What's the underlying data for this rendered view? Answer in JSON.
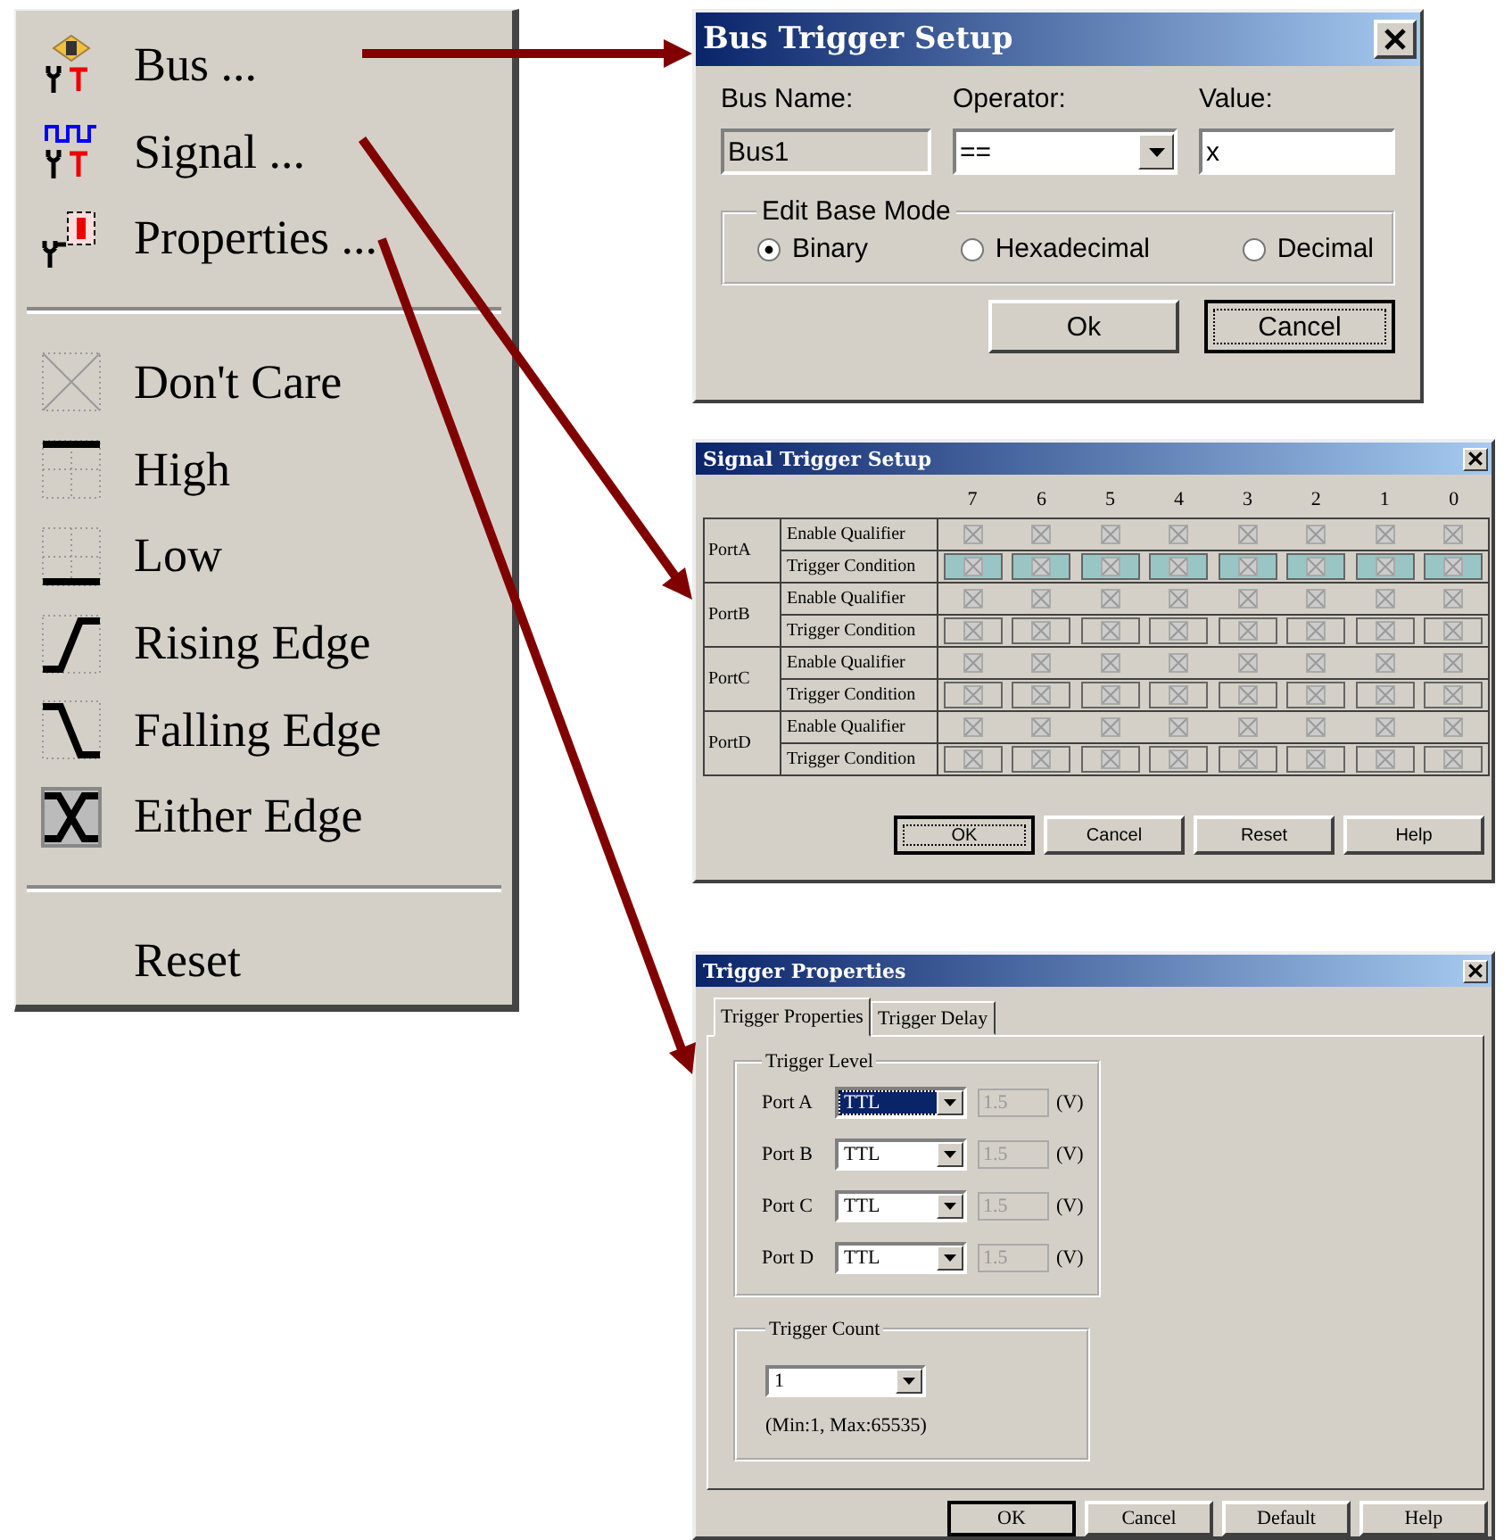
{
  "menu": {
    "groups": [
      [
        {
          "kind": "bus",
          "label": "Bus ..."
        },
        {
          "kind": "signal",
          "label": "Signal ..."
        },
        {
          "kind": "properties",
          "label": "Properties ..."
        }
      ],
      [
        {
          "kind": "dont-care",
          "label": "Don't Care"
        },
        {
          "kind": "high",
          "label": "High"
        },
        {
          "kind": "low",
          "label": "Low"
        },
        {
          "kind": "rising",
          "label": "Rising Edge"
        },
        {
          "kind": "falling",
          "label": "Falling Edge"
        },
        {
          "kind": "either",
          "label": "Either Edge"
        }
      ],
      [
        {
          "kind": "plain",
          "label": "Reset"
        }
      ]
    ]
  },
  "bus_dialog": {
    "title": "Bus Trigger Setup",
    "bus_name": {
      "label": "Bus Name:",
      "value": "Bus1"
    },
    "operator": {
      "label": "Operator:",
      "value": "=="
    },
    "value": {
      "label": "Value:",
      "value": "x"
    },
    "base_mode": {
      "legend": "Edit Base Mode",
      "options": [
        {
          "label": "Binary",
          "selected": true
        },
        {
          "label": "Hexadecimal",
          "selected": false
        },
        {
          "label": "Decimal",
          "selected": false
        }
      ]
    },
    "buttons": [
      {
        "label": "Ok",
        "focused": false
      },
      {
        "label": "Cancel",
        "focused": true
      }
    ]
  },
  "signal_dialog": {
    "title": "Signal Trigger Setup",
    "columns": [
      "7",
      "6",
      "5",
      "4",
      "3",
      "2",
      "1",
      "0"
    ],
    "ports": [
      {
        "name": "PortA",
        "rows": [
          {
            "label": "Enable Qualifier",
            "kind": "qualifier"
          },
          {
            "label": "Trigger Condition",
            "kind": "condition",
            "highlighted": true
          }
        ]
      },
      {
        "name": "PortB",
        "rows": [
          {
            "label": "Enable Qualifier",
            "kind": "qualifier"
          },
          {
            "label": "Trigger Condition",
            "kind": "condition",
            "highlighted": false
          }
        ]
      },
      {
        "name": "PortC",
        "rows": [
          {
            "label": "Enable Qualifier",
            "kind": "qualifier"
          },
          {
            "label": "Trigger Condition",
            "kind": "condition",
            "highlighted": false
          }
        ]
      },
      {
        "name": "PortD",
        "rows": [
          {
            "label": "Enable Qualifier",
            "kind": "qualifier"
          },
          {
            "label": "Trigger Condition",
            "kind": "condition",
            "highlighted": false
          }
        ]
      }
    ],
    "buttons": [
      {
        "label": "OK",
        "focused": true
      },
      {
        "label": "Cancel",
        "focused": false
      },
      {
        "label": "Reset",
        "focused": false
      },
      {
        "label": "Help",
        "focused": false
      }
    ]
  },
  "properties_dialog": {
    "title": "Trigger Properties",
    "tabs": [
      {
        "label": "Trigger Properties",
        "selected": true
      },
      {
        "label": "Trigger Delay",
        "selected": false
      }
    ],
    "level_group": {
      "legend": "Trigger Level",
      "ports": [
        {
          "label": "Port A",
          "value": "TTL",
          "voltage": "1.5",
          "unit": "(V)",
          "focused": true
        },
        {
          "label": "Port B",
          "value": "TTL",
          "voltage": "1.5",
          "unit": "(V)",
          "focused": false
        },
        {
          "label": "Port C",
          "value": "TTL",
          "voltage": "1.5",
          "unit": "(V)",
          "focused": false
        },
        {
          "label": "Port D",
          "value": "TTL",
          "voltage": "1.5",
          "unit": "(V)",
          "focused": false
        }
      ]
    },
    "count_group": {
      "legend": "Trigger Count",
      "value": "1",
      "hint": "(Min:1, Max:65535)"
    },
    "buttons": [
      {
        "label": "OK",
        "focused": true
      },
      {
        "label": "Cancel",
        "focused": false
      },
      {
        "label": "Default",
        "focused": false
      },
      {
        "label": "Help",
        "focused": false
      }
    ]
  }
}
